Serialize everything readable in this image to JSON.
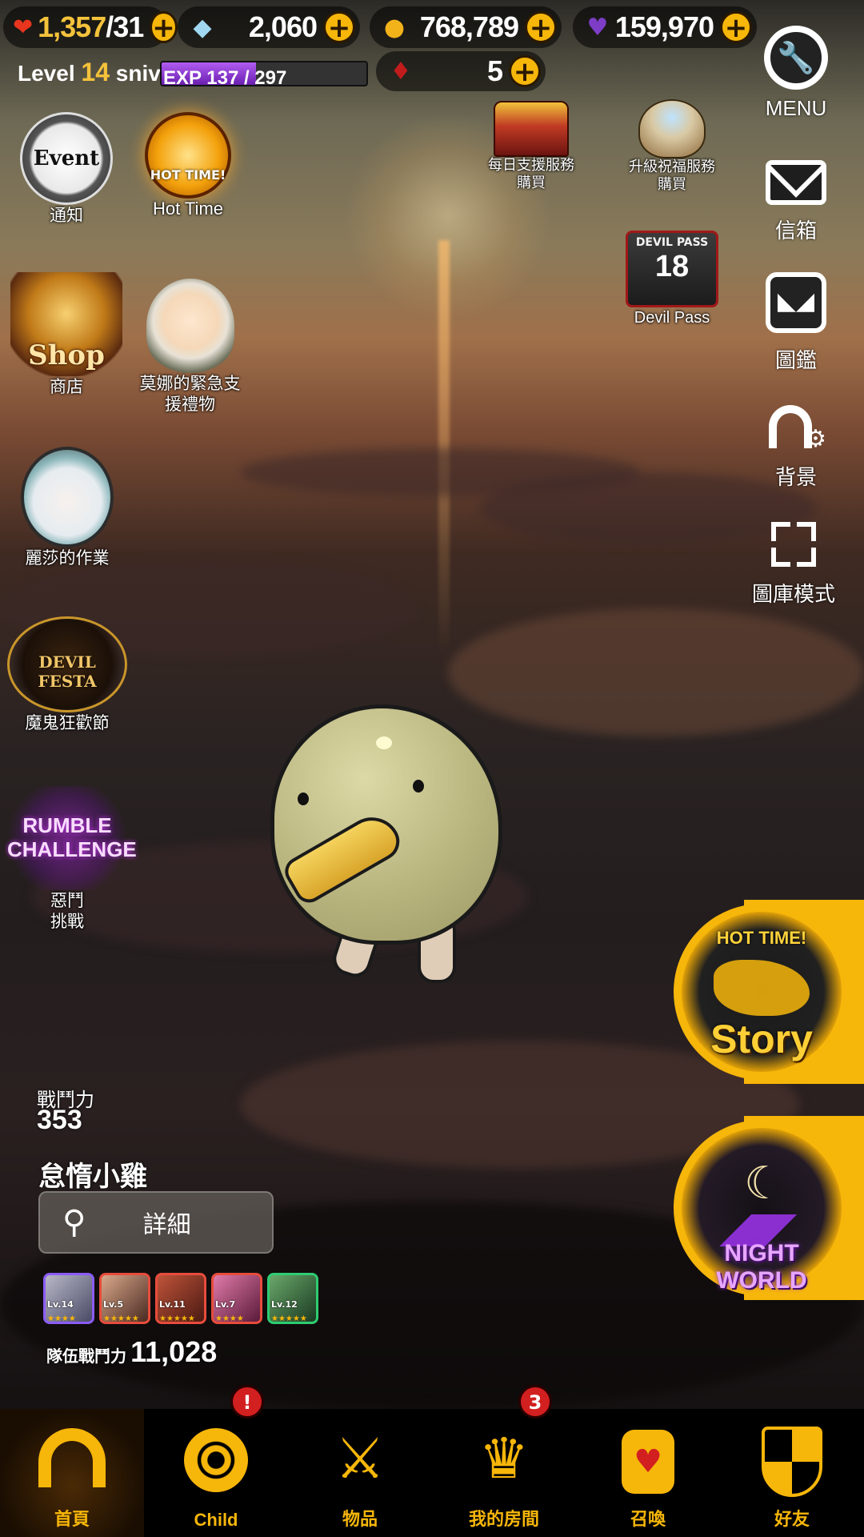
{
  "resources": {
    "hearts": "1,357",
    "hearts_max": "/31",
    "gems": "2,060",
    "gold": "768,789",
    "dark_gems": "159,970",
    "red_gems": "5"
  },
  "player": {
    "level_prefix": "Level",
    "level": "14",
    "name": "snivy",
    "exp_text": "EXP 137 / 297",
    "exp_progress": 0.46
  },
  "left_icons": {
    "notice_label": "通知",
    "notice_art": "Event",
    "hottime_label": "Hot Time",
    "hottime_art": "HOT TIME!",
    "shop_label": "商店",
    "shop_art": "Shop",
    "mona_label": "莫娜的緊急支援禮物",
    "lisa_label": "麗莎的作業",
    "festa_label": "魔鬼狂歡節",
    "festa_art": "DEVIL FESTA",
    "rumble_label": "惡鬥挑戰",
    "rumble_art": "RUMBLE CHALLENGE"
  },
  "top_right_shop": {
    "daily_label": "每日支援服務購買",
    "upgrade_label": "升級祝福服務購買",
    "devilpass_label": "Devil Pass",
    "devilpass_num": "18",
    "devilpass_art": "DEVIL PASS"
  },
  "right_menu": {
    "menu_label": "MENU",
    "mail_label": "信箱",
    "collection_label": "圖鑑",
    "background_label": "背景",
    "gallery_label": "圖庫模式"
  },
  "character": {
    "power_label": "戰鬥力",
    "power_value": "353",
    "name": "怠惰小雞",
    "detail_label": "詳細"
  },
  "team": {
    "members": [
      {
        "level": "Lv.14"
      },
      {
        "level": "Lv.5"
      },
      {
        "level": "Lv.11"
      },
      {
        "level": "Lv.7"
      },
      {
        "level": "Lv.12"
      }
    ],
    "power_label": "隊伍戰鬥力",
    "power_value": "11,028"
  },
  "banners": {
    "story_top": "HOT TIME!",
    "story_label": "Story",
    "night_label": "NIGHT WORLD"
  },
  "nav": {
    "home": "首頁",
    "child": "Child",
    "child_badge": "!",
    "items": "物品",
    "room": "我的房間",
    "room_badge": "3",
    "summon": "召喚",
    "friends": "好友"
  },
  "colors": {
    "accent": "#f6b60a",
    "exp": "#9b3fe0",
    "badge": "#d21f1f"
  }
}
